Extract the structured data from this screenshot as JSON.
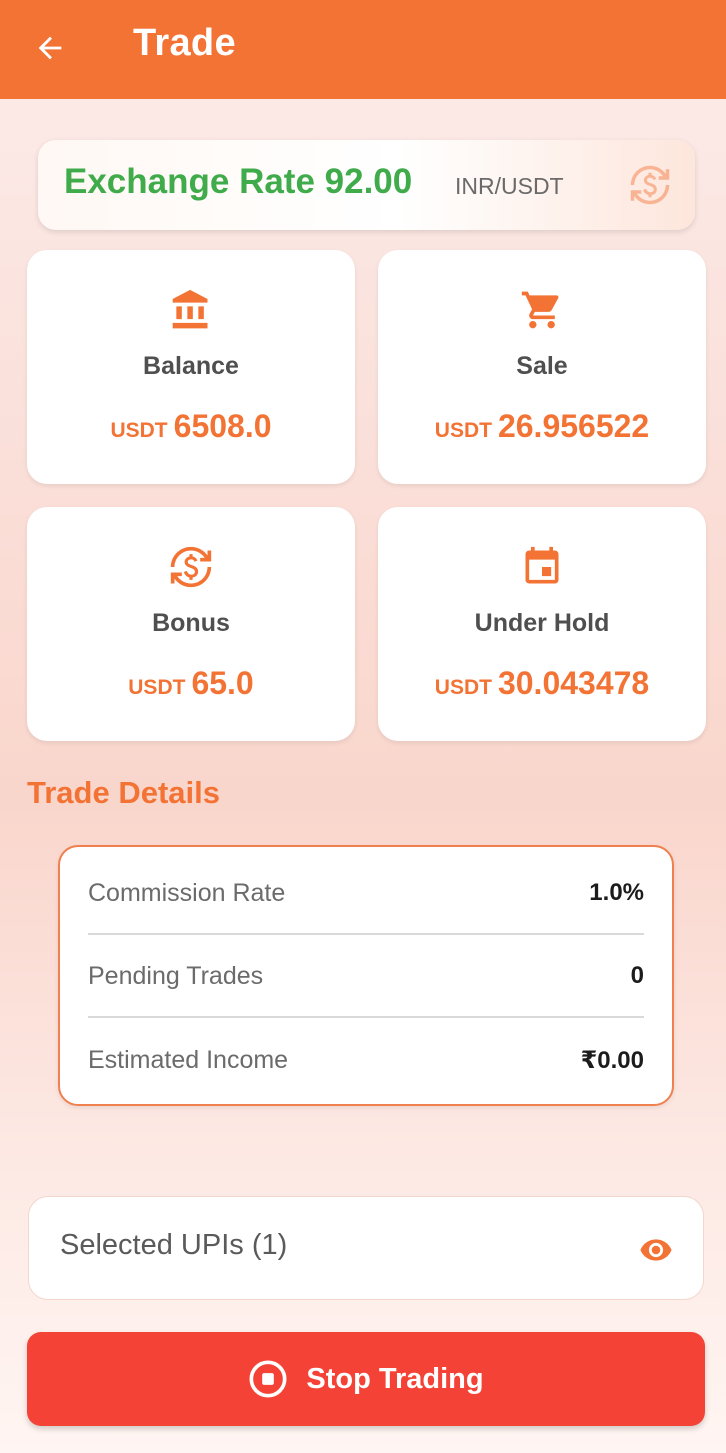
{
  "colors": {
    "primary": "#f37335",
    "exchange_green": "#3fab4a",
    "stop_red": "#f44336"
  },
  "appbar": {
    "title": "Trade",
    "back_icon": "arrow-left-icon"
  },
  "exchange": {
    "label": "Exchange Rate 92.00",
    "unit": "INR/USDT",
    "icon": "currency-exchange-icon"
  },
  "stats": [
    {
      "label": "Balance",
      "currency": "USDT",
      "value": "6508.0",
      "icon": "bank-icon"
    },
    {
      "label": "Sale",
      "currency": "USDT",
      "value": "26.956522",
      "icon": "cart-icon"
    },
    {
      "label": "Bonus",
      "currency": "USDT",
      "value": "65.0",
      "icon": "currency-exchange-icon"
    },
    {
      "label": "Under Hold",
      "currency": "USDT",
      "value": "30.043478",
      "icon": "calendar-icon"
    }
  ],
  "trade_details": {
    "title": "Trade Details",
    "rows": [
      {
        "key": "Commission Rate",
        "value": "1.0%"
      },
      {
        "key": "Pending Trades",
        "value": "0"
      },
      {
        "key": "Estimated Income",
        "value": "₹0.00"
      }
    ]
  },
  "upi": {
    "label": "Selected UPIs (1)",
    "icon": "eye-icon"
  },
  "stop_button": {
    "label": "Stop Trading",
    "icon": "stop-circle-icon"
  }
}
